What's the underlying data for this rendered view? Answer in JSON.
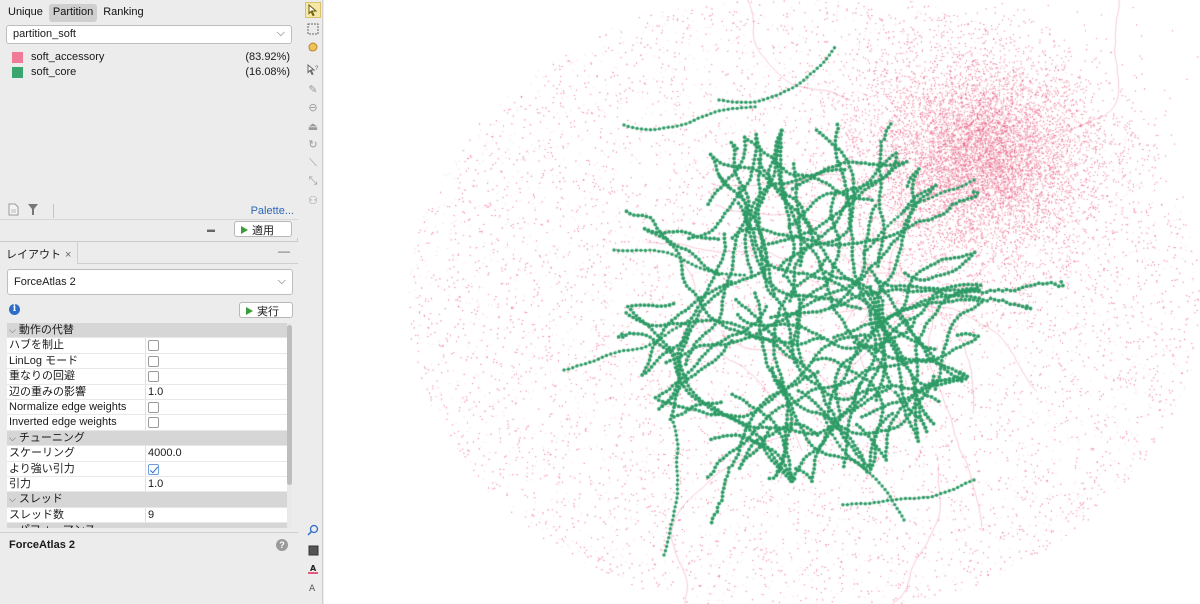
{
  "appearance": {
    "tabs": [
      "Unique",
      "Partition",
      "Ranking"
    ],
    "active_tab": "Partition",
    "partition_select": "partition_soft",
    "legend": [
      {
        "label": "soft_accessory",
        "percent": "(83.92%)",
        "color": "#f07b97"
      },
      {
        "label": "soft_core",
        "percent": "(16.08%)",
        "color": "#3aa66e"
      }
    ],
    "palette_link": "Palette...",
    "apply_label": "適用"
  },
  "layout": {
    "tab_label": "レイアウト",
    "algorithm": "ForceAtlas 2",
    "run_label": "実行",
    "categories": [
      {
        "name": "動作の代替",
        "rows": [
          {
            "name": "ハブを制止",
            "type": "checkbox",
            "checked": false
          },
          {
            "name": "LinLog モード",
            "type": "checkbox",
            "checked": false
          },
          {
            "name": "重なりの回避",
            "type": "checkbox",
            "checked": false
          },
          {
            "name": "辺の重みの影響",
            "type": "text",
            "value": "1.0"
          },
          {
            "name": "Normalize edge weights",
            "type": "checkbox",
            "checked": false
          },
          {
            "name": "Inverted edge weights",
            "type": "checkbox",
            "checked": false
          }
        ]
      },
      {
        "name": "チューニング",
        "rows": [
          {
            "name": "スケーリング",
            "type": "text",
            "value": "4000.0"
          },
          {
            "name": "より強い引力",
            "type": "checkbox",
            "checked": true
          },
          {
            "name": "引力",
            "type": "text",
            "value": "1.0"
          }
        ]
      },
      {
        "name": "スレッド",
        "rows": [
          {
            "name": "スレッド数",
            "type": "text",
            "value": "9"
          }
        ]
      },
      {
        "name": "パフォーマンス",
        "rows": []
      }
    ],
    "description_title": "ForceAtlas 2"
  },
  "colors": {
    "accessory_node": "#e8577d",
    "core_node": "#2e9b66",
    "accent_link": "#2b67b5"
  }
}
